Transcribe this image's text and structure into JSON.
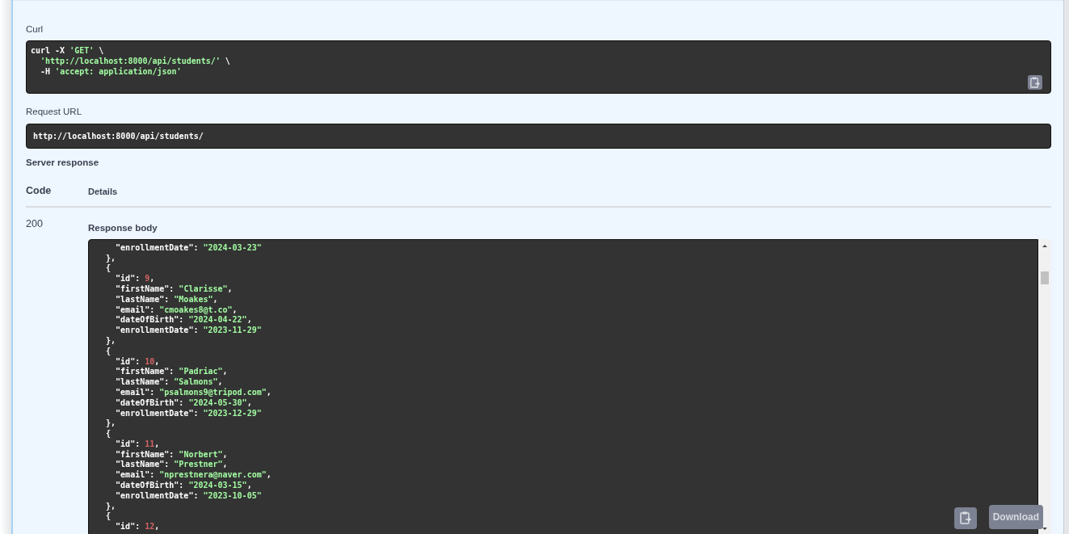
{
  "curl": {
    "label": "Curl",
    "lines": [
      [
        {
          "kind": "plain",
          "text": "curl -X "
        },
        {
          "kind": "string",
          "text": "'GET'"
        },
        {
          "kind": "plain",
          "text": " \\"
        }
      ],
      [
        {
          "kind": "string",
          "text": "  'http://localhost:8000/api/students/'"
        },
        {
          "kind": "plain",
          "text": " \\"
        }
      ],
      [
        {
          "kind": "plain",
          "text": "  -H "
        },
        {
          "kind": "string",
          "text": "'accept: application/json'"
        }
      ]
    ]
  },
  "request_url": {
    "label": "Request URL",
    "value": "http://localhost:8000/api/students/"
  },
  "server_response": {
    "label": "Server response",
    "columns": [
      "Code",
      "Details"
    ],
    "code": "200",
    "body_label": "Response body",
    "body_lines": [
      [
        {
          "kind": "plain",
          "text": "    \"enrollmentDate\": "
        },
        {
          "kind": "string",
          "text": "\"2024-03-23\""
        }
      ],
      [
        {
          "kind": "plain",
          "text": "  },"
        }
      ],
      [
        {
          "kind": "plain",
          "text": "  {"
        }
      ],
      [
        {
          "kind": "plain",
          "text": "    \"id\": "
        },
        {
          "kind": "number",
          "text": "9"
        },
        {
          "kind": "plain",
          "text": ","
        }
      ],
      [
        {
          "kind": "plain",
          "text": "    \"firstName\": "
        },
        {
          "kind": "string",
          "text": "\"Clarisse\""
        },
        {
          "kind": "plain",
          "text": ","
        }
      ],
      [
        {
          "kind": "plain",
          "text": "    \"lastName\": "
        },
        {
          "kind": "string",
          "text": "\"Moakes\""
        },
        {
          "kind": "plain",
          "text": ","
        }
      ],
      [
        {
          "kind": "plain",
          "text": "    \"email\": "
        },
        {
          "kind": "string",
          "text": "\"cmoakes8@t.co\""
        },
        {
          "kind": "plain",
          "text": ","
        }
      ],
      [
        {
          "kind": "plain",
          "text": "    \"dateOfBirth\": "
        },
        {
          "kind": "string",
          "text": "\"2024-04-22\""
        },
        {
          "kind": "plain",
          "text": ","
        }
      ],
      [
        {
          "kind": "plain",
          "text": "    \"enrollmentDate\": "
        },
        {
          "kind": "string",
          "text": "\"2023-11-29\""
        }
      ],
      [
        {
          "kind": "plain",
          "text": "  },"
        }
      ],
      [
        {
          "kind": "plain",
          "text": "  {"
        }
      ],
      [
        {
          "kind": "plain",
          "text": "    \"id\": "
        },
        {
          "kind": "number",
          "text": "10"
        },
        {
          "kind": "plain",
          "text": ","
        }
      ],
      [
        {
          "kind": "plain",
          "text": "    \"firstName\": "
        },
        {
          "kind": "string",
          "text": "\"Padriac\""
        },
        {
          "kind": "plain",
          "text": ","
        }
      ],
      [
        {
          "kind": "plain",
          "text": "    \"lastName\": "
        },
        {
          "kind": "string",
          "text": "\"Salmons\""
        },
        {
          "kind": "plain",
          "text": ","
        }
      ],
      [
        {
          "kind": "plain",
          "text": "    \"email\": "
        },
        {
          "kind": "string",
          "text": "\"psalmons9@tripod.com\""
        },
        {
          "kind": "plain",
          "text": ","
        }
      ],
      [
        {
          "kind": "plain",
          "text": "    \"dateOfBirth\": "
        },
        {
          "kind": "string",
          "text": "\"2024-05-30\""
        },
        {
          "kind": "plain",
          "text": ","
        }
      ],
      [
        {
          "kind": "plain",
          "text": "    \"enrollmentDate\": "
        },
        {
          "kind": "string",
          "text": "\"2023-12-29\""
        }
      ],
      [
        {
          "kind": "plain",
          "text": "  },"
        }
      ],
      [
        {
          "kind": "plain",
          "text": "  {"
        }
      ],
      [
        {
          "kind": "plain",
          "text": "    \"id\": "
        },
        {
          "kind": "number",
          "text": "11"
        },
        {
          "kind": "plain",
          "text": ","
        }
      ],
      [
        {
          "kind": "plain",
          "text": "    \"firstName\": "
        },
        {
          "kind": "string",
          "text": "\"Norbert\""
        },
        {
          "kind": "plain",
          "text": ","
        }
      ],
      [
        {
          "kind": "plain",
          "text": "    \"lastName\": "
        },
        {
          "kind": "string",
          "text": "\"Prestner\""
        },
        {
          "kind": "plain",
          "text": ","
        }
      ],
      [
        {
          "kind": "plain",
          "text": "    \"email\": "
        },
        {
          "kind": "string",
          "text": "\"nprestnera@naver.com\""
        },
        {
          "kind": "plain",
          "text": ","
        }
      ],
      [
        {
          "kind": "plain",
          "text": "    \"dateOfBirth\": "
        },
        {
          "kind": "string",
          "text": "\"2024-03-15\""
        },
        {
          "kind": "plain",
          "text": ","
        }
      ],
      [
        {
          "kind": "plain",
          "text": "    \"enrollmentDate\": "
        },
        {
          "kind": "string",
          "text": "\"2023-10-05\""
        }
      ],
      [
        {
          "kind": "plain",
          "text": "  },"
        }
      ],
      [
        {
          "kind": "plain",
          "text": "  {"
        }
      ],
      [
        {
          "kind": "plain",
          "text": "    \"id\": "
        },
        {
          "kind": "number",
          "text": "12"
        },
        {
          "kind": "plain",
          "text": ","
        }
      ]
    ],
    "download_button": "Download"
  }
}
